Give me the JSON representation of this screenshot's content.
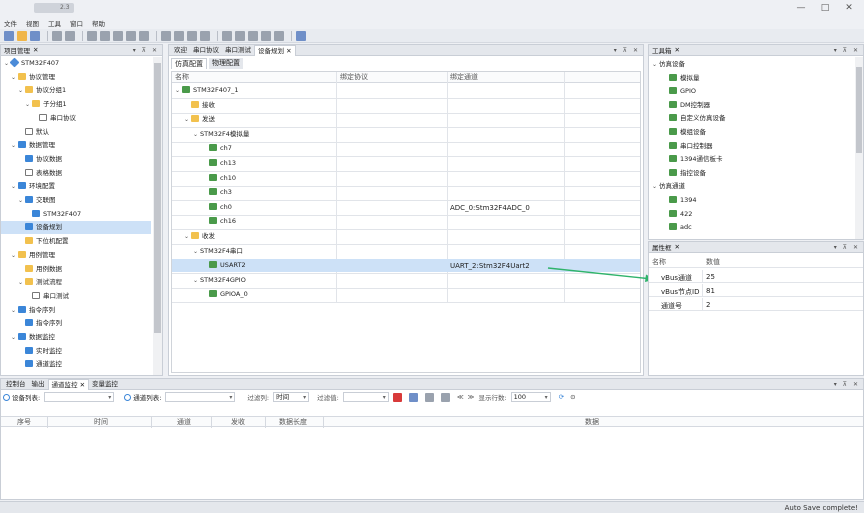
{
  "window": {
    "title": "2.3",
    "min": "—",
    "max": "□",
    "close": "✕"
  },
  "menu": [
    "文件",
    "视图",
    "工具",
    "窗口",
    "帮助"
  ],
  "project": {
    "title": "项目管理",
    "items": [
      {
        "label": "STM32F407",
        "lvl": 0,
        "ico": "rom",
        "exp": "v"
      },
      {
        "label": "协议管理",
        "lvl": 1,
        "ico": "fold",
        "exp": "v"
      },
      {
        "label": "协议分组1",
        "lvl": 2,
        "ico": "fold",
        "exp": "v"
      },
      {
        "label": "子分组1",
        "lvl": 3,
        "ico": "fold",
        "exp": "v"
      },
      {
        "label": "串口协议",
        "lvl": 4,
        "ico": "doc",
        "exp": ""
      },
      {
        "label": "默认",
        "lvl": 2,
        "ico": "doc",
        "exp": ""
      },
      {
        "label": "数据管理",
        "lvl": 1,
        "ico": "blue",
        "exp": "v"
      },
      {
        "label": "协议数据",
        "lvl": 2,
        "ico": "blue",
        "exp": ""
      },
      {
        "label": "表格数据",
        "lvl": 2,
        "ico": "doc",
        "exp": ""
      },
      {
        "label": "环境配置",
        "lvl": 1,
        "ico": "blue",
        "exp": "v"
      },
      {
        "label": "交联图",
        "lvl": 2,
        "ico": "blue",
        "exp": "v"
      },
      {
        "label": "STM32F407",
        "lvl": 3,
        "ico": "blue",
        "exp": ""
      },
      {
        "label": "设备规划",
        "lvl": 2,
        "ico": "blue",
        "exp": "",
        "sel": true
      },
      {
        "label": "下位机配置",
        "lvl": 2,
        "ico": "fold",
        "exp": ""
      },
      {
        "label": "用例管理",
        "lvl": 1,
        "ico": "fold",
        "exp": "v"
      },
      {
        "label": "用例数据",
        "lvl": 2,
        "ico": "fold",
        "exp": ""
      },
      {
        "label": "测试流程",
        "lvl": 2,
        "ico": "fold",
        "exp": "v"
      },
      {
        "label": "串口测试",
        "lvl": 3,
        "ico": "doc",
        "exp": ""
      },
      {
        "label": "指令序列",
        "lvl": 1,
        "ico": "blue",
        "exp": "v"
      },
      {
        "label": "指令序列",
        "lvl": 2,
        "ico": "blue",
        "exp": ""
      },
      {
        "label": "数据监控",
        "lvl": 1,
        "ico": "blue",
        "exp": "v"
      },
      {
        "label": "实时监控",
        "lvl": 2,
        "ico": "blue",
        "exp": ""
      },
      {
        "label": "通道监控",
        "lvl": 2,
        "ico": "blue",
        "exp": ""
      }
    ]
  },
  "docTabs": [
    "欢迎",
    "串口协议",
    "串口测试",
    "设备规划"
  ],
  "subTabs": [
    "仿真配置",
    "物理配置"
  ],
  "grid": {
    "headers": [
      "名称",
      "绑定协议",
      "绑定通道"
    ],
    "rows": [
      {
        "label": "STM32F407_1",
        "lvl": 0,
        "ico": "dev",
        "exp": "v",
        "proto": "",
        "chan": ""
      },
      {
        "label": "接收",
        "lvl": 1,
        "ico": "fold",
        "exp": "",
        "proto": "",
        "chan": ""
      },
      {
        "label": "发送",
        "lvl": 1,
        "ico": "fold",
        "exp": "v",
        "proto": "",
        "chan": ""
      },
      {
        "label": "STM32F4模拟量",
        "lvl": 2,
        "ico": "",
        "exp": "v",
        "proto": "",
        "chan": ""
      },
      {
        "label": "ch7",
        "lvl": 3,
        "ico": "dev",
        "exp": "",
        "proto": "",
        "chan": ""
      },
      {
        "label": "ch13",
        "lvl": 3,
        "ico": "dev",
        "exp": "",
        "proto": "",
        "chan": ""
      },
      {
        "label": "ch10",
        "lvl": 3,
        "ico": "dev",
        "exp": "",
        "proto": "",
        "chan": ""
      },
      {
        "label": "ch3",
        "lvl": 3,
        "ico": "dev",
        "exp": "",
        "proto": "",
        "chan": ""
      },
      {
        "label": "ch0",
        "lvl": 3,
        "ico": "dev",
        "exp": "",
        "proto": "",
        "chan": "ADC_0:Stm32F4ADC_0"
      },
      {
        "label": "ch16",
        "lvl": 3,
        "ico": "dev",
        "exp": "",
        "proto": "",
        "chan": ""
      },
      {
        "label": "收发",
        "lvl": 1,
        "ico": "fold",
        "exp": "v",
        "proto": "",
        "chan": ""
      },
      {
        "label": "STM32F4串口",
        "lvl": 2,
        "ico": "",
        "exp": "v",
        "proto": "",
        "chan": ""
      },
      {
        "label": "USART2",
        "lvl": 3,
        "ico": "dev",
        "exp": "",
        "proto": "",
        "chan": "UART_2:Stm32F4Uart2",
        "sel": true
      },
      {
        "label": "STM32F4GPIO",
        "lvl": 2,
        "ico": "",
        "exp": "v",
        "proto": "",
        "chan": ""
      },
      {
        "label": "GPIOA_0",
        "lvl": 3,
        "ico": "dev",
        "exp": "",
        "proto": "",
        "chan": ""
      }
    ]
  },
  "tools": {
    "title": "工具箱",
    "items": [
      {
        "label": "仿真设备",
        "lvl": 0,
        "ico": "",
        "exp": "v"
      },
      {
        "label": "模拟量",
        "lvl": 1,
        "ico": "dev"
      },
      {
        "label": "GPIO",
        "lvl": 1,
        "ico": "dev"
      },
      {
        "label": "DM控制器",
        "lvl": 1,
        "ico": "dev"
      },
      {
        "label": "自定义仿真设备",
        "lvl": 1,
        "ico": "dev"
      },
      {
        "label": "模组设备",
        "lvl": 1,
        "ico": "dev"
      },
      {
        "label": "串口控制器",
        "lvl": 1,
        "ico": "dev"
      },
      {
        "label": "1394通信板卡",
        "lvl": 1,
        "ico": "dev"
      },
      {
        "label": "指控设备",
        "lvl": 1,
        "ico": "dev"
      },
      {
        "label": "仿真通道",
        "lvl": 0,
        "ico": "",
        "exp": "v"
      },
      {
        "label": "1394",
        "lvl": 1,
        "ico": "dev"
      },
      {
        "label": "422",
        "lvl": 1,
        "ico": "dev"
      },
      {
        "label": "adc",
        "lvl": 1,
        "ico": "dev"
      }
    ]
  },
  "props": {
    "title": "属性框",
    "headers": [
      "名称",
      "数值"
    ],
    "rows": [
      {
        "k": "vBus通道",
        "v": "25"
      },
      {
        "k": "vBus节点ID",
        "v": "81"
      },
      {
        "k": "通道号",
        "v": "2"
      }
    ]
  },
  "bottomTabs": [
    "控制台",
    "输出",
    "通道监控",
    "变量监控"
  ],
  "bottomBar": {
    "device": "设备列表:",
    "channel": "通道列表:",
    "filterCol": "过滤列:",
    "filterColVal": "时间",
    "filterVal": "过滤值:",
    "showRows": "显示行数:",
    "showRowsVal": "100"
  },
  "logHeaders": [
    "序号",
    "时间",
    "通道",
    "发收",
    "数据长度",
    "数据"
  ],
  "status": "Auto Save complete!"
}
